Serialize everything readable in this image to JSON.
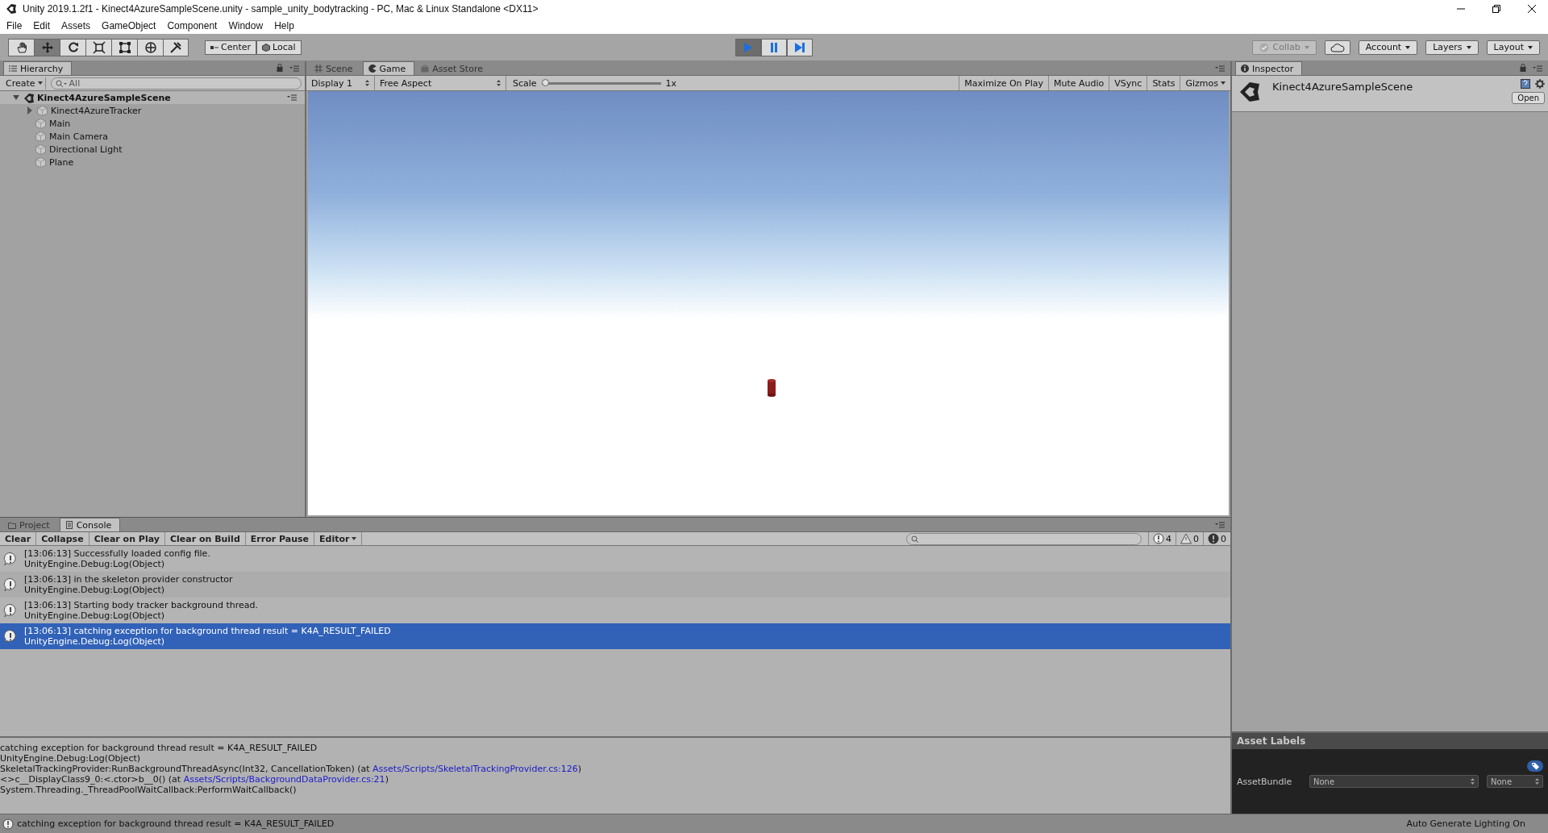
{
  "window": {
    "title": "Unity 2019.1.2f1 - Kinect4AzureSampleScene.unity - sample_unity_bodytracking - PC, Mac & Linux Standalone <DX11>"
  },
  "menu": [
    "File",
    "Edit",
    "Assets",
    "GameObject",
    "Component",
    "Window",
    "Help"
  ],
  "toolbar": {
    "tools": [
      {
        "kind": "hand",
        "selected": false
      },
      {
        "kind": "move",
        "selected": true
      },
      {
        "kind": "rotate",
        "selected": false
      },
      {
        "kind": "scale",
        "selected": false
      },
      {
        "kind": "rect",
        "selected": false
      },
      {
        "kind": "transform",
        "selected": false
      },
      {
        "kind": "custom",
        "selected": false
      }
    ],
    "pivot": [
      "Center",
      "Local"
    ],
    "play": [
      {
        "kind": "play",
        "selected": true
      },
      {
        "kind": "pause",
        "selected": false
      },
      {
        "kind": "step",
        "selected": false
      }
    ],
    "collab": "Collab",
    "account": "Account",
    "layers": "Layers",
    "layout": "Layout"
  },
  "hierarchy": {
    "tab": "Hierarchy",
    "create": "Create",
    "search": {
      "placeholder": "All"
    },
    "scene": {
      "name": "Kinect4AzureSampleScene",
      "expanded": true,
      "children": [
        {
          "name": "Kinect4AzureTracker",
          "expanded": false
        },
        {
          "name": "Main"
        },
        {
          "name": "Main Camera"
        },
        {
          "name": "Directional Light"
        },
        {
          "name": "Plane"
        }
      ]
    }
  },
  "view_tabs": [
    {
      "label": "Scene",
      "kind": "scene",
      "selected": false
    },
    {
      "label": "Game",
      "kind": "game",
      "selected": true
    },
    {
      "label": "Asset Store",
      "kind": "store",
      "selected": false
    }
  ],
  "game_bar": {
    "display": "Display 1",
    "aspect": "Free Aspect",
    "scale_label": "Scale",
    "scale": {
      "level": 0
    },
    "scale_value": "1x",
    "toggles": [
      "Maximize On Play",
      "Mute Audio",
      "VSync",
      "Stats",
      "Gizmos"
    ]
  },
  "inspector": {
    "tab": "Inspector",
    "object": "Kinect4AzureSampleScene",
    "open": "Open",
    "asset_labels": "Asset Labels",
    "asset_bundle": "AssetBundle",
    "bundle": "None",
    "variant": "None"
  },
  "console": {
    "tabs": [
      {
        "label": "Project",
        "kind": "project",
        "selected": false
      },
      {
        "label": "Console",
        "kind": "console",
        "selected": true
      }
    ],
    "buttons": [
      "Clear",
      "Collapse",
      "Clear on Play",
      "Clear on Build",
      "Error Pause",
      "Editor"
    ],
    "counts": [
      {
        "kind": "info",
        "count": "4"
      },
      {
        "kind": "warning",
        "count": "0"
      },
      {
        "kind": "error",
        "count": "0"
      }
    ],
    "entries": [
      {
        "message": "[13:06:13] Successfully loaded config file.",
        "source": "UnityEngine.Debug:Log(Object)",
        "selected": false
      },
      {
        "message": "[13:06:13] in the skeleton provider constructor",
        "source": "UnityEngine.Debug:Log(Object)",
        "selected": false
      },
      {
        "message": "[13:06:13] Starting body tracker background thread.",
        "source": "UnityEngine.Debug:Log(Object)",
        "selected": false
      },
      {
        "message": "[13:06:13] catching exception for background thread result = K4A_RESULT_FAILED",
        "source": "UnityEngine.Debug:Log(Object)",
        "selected": true
      }
    ],
    "detail": [
      [
        {
          "kind": "text",
          "text": "catching exception for background thread result = K4A_RESULT_FAILED"
        }
      ],
      [
        {
          "kind": "text",
          "text": "UnityEngine.Debug:Log(Object)"
        }
      ],
      [
        {
          "kind": "text",
          "text": "SkeletalTrackingProvider:RunBackgroundThreadAsync(Int32, CancellationToken) (at "
        },
        {
          "kind": "link",
          "text": "Assets/Scripts/SkeletalTrackingProvider.cs:126"
        },
        {
          "kind": "text",
          "text": ")"
        }
      ],
      [
        {
          "kind": "text",
          "text": "<>c__DisplayClass9_0:<.ctor>b__0() (at "
        },
        {
          "kind": "link",
          "text": "Assets/Scripts/BackgroundDataProvider.cs:21"
        },
        {
          "kind": "text",
          "text": ")"
        }
      ],
      [
        {
          "kind": "text",
          "text": "System.Threading._ThreadPoolWaitCallback:PerformWaitCallback()"
        }
      ]
    ]
  },
  "status_bar": {
    "message": "catching exception for background thread result = K4A_RESULT_FAILED",
    "lighting": "Auto Generate Lighting On"
  }
}
